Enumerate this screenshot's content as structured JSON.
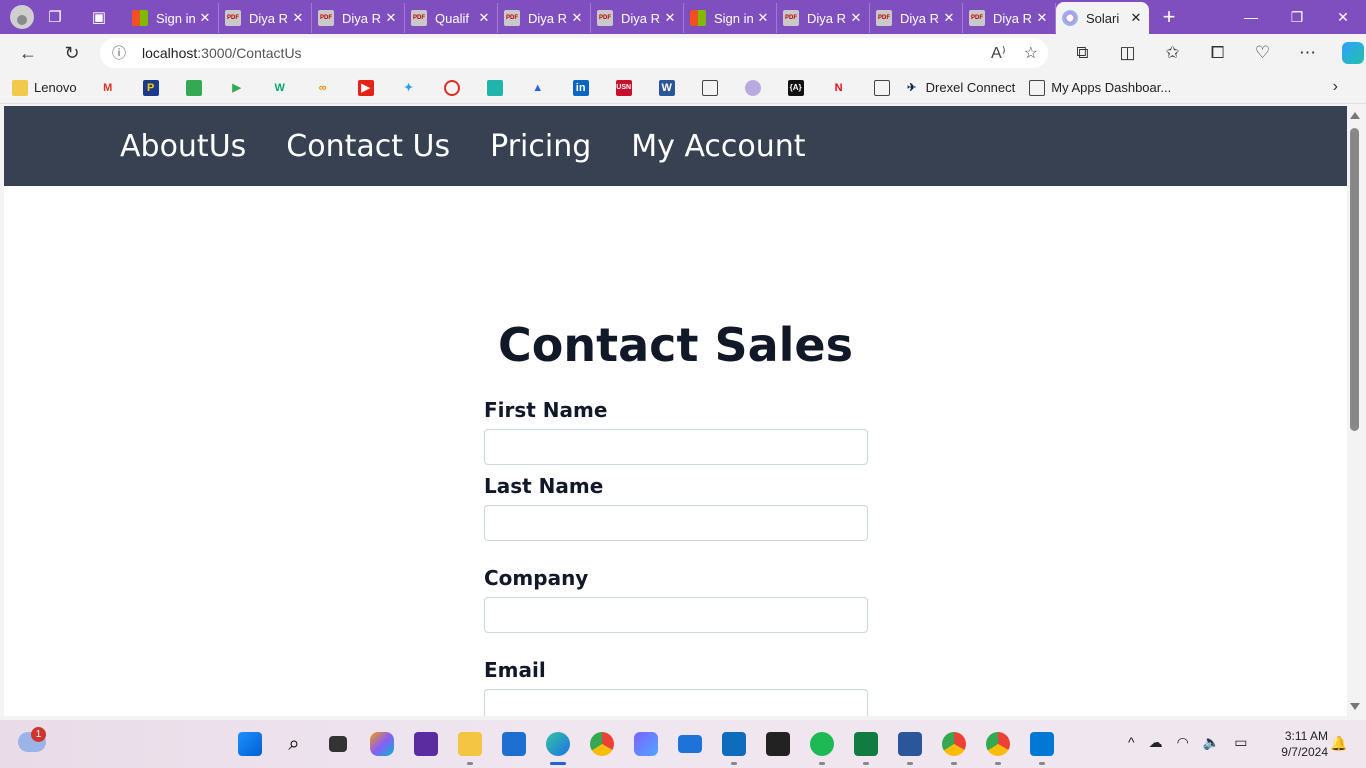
{
  "browser": {
    "tabs": [
      {
        "title": "Sign in",
        "favicon": "microsoft",
        "close": "✕"
      },
      {
        "title": "Diya R",
        "favicon": "pdf",
        "close": "✕"
      },
      {
        "title": "Diya R",
        "favicon": "pdf",
        "close": "✕"
      },
      {
        "title": "Qualif",
        "favicon": "pdf",
        "close": "✕"
      },
      {
        "title": "Diya R",
        "favicon": "pdf",
        "close": "✕"
      },
      {
        "title": "Diya R",
        "favicon": "pdf",
        "close": "✕"
      },
      {
        "title": "Sign in",
        "favicon": "microsoft",
        "close": "✕"
      },
      {
        "title": "Diya R",
        "favicon": "pdf",
        "close": "✕"
      },
      {
        "title": "Diya R",
        "favicon": "pdf",
        "close": "✕"
      },
      {
        "title": "Diya R",
        "favicon": "pdf",
        "close": "✕"
      },
      {
        "title": "Solari",
        "favicon": "solari",
        "close": "✕",
        "active": true
      }
    ],
    "new_tab": "+",
    "address": {
      "host": "localhost",
      "path": ":3000/ContactUs"
    },
    "bookmarks": {
      "lenovo": "Lenovo",
      "drexel": "Drexel Connect",
      "myapps": "My Apps Dashboar..."
    }
  },
  "page": {
    "nav": {
      "about": "AboutUs",
      "contact": "Contact Us",
      "pricing": "Pricing",
      "account": "My Account"
    },
    "heading": "Contact Sales",
    "form": {
      "first_name_label": "First Name",
      "last_name_label": "Last Name",
      "company_label": "Company",
      "email_label": "Email"
    }
  },
  "taskbar": {
    "weather_badge": "1",
    "time": "3:11 AM",
    "date": "9/7/2024"
  },
  "colors": {
    "tab_strip": "#7f4fbf",
    "navbar": "#374151",
    "heading": "#111827"
  }
}
